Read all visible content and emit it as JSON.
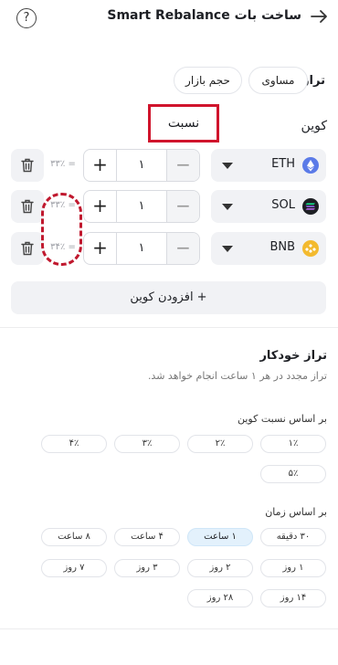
{
  "header": {
    "title": "ساخت بات Smart Rebalance",
    "help_symbol": "?"
  },
  "balance": {
    "label": "تراز",
    "options": [
      "مساوی",
      "حجم بازار"
    ]
  },
  "columns": {
    "coin": "کوین",
    "ratio": "نسبت"
  },
  "coins": [
    {
      "name": "ETH",
      "amount": "۱",
      "percent": "= ۳۳٪",
      "logo_color": "#5b7be8"
    },
    {
      "name": "SOL",
      "amount": "۱",
      "percent": "= ۳۳٪",
      "logo_color": "#7b4fe0"
    },
    {
      "name": "BNB",
      "amount": "۱",
      "percent": "= ۳۴٪",
      "logo_color": "#f3ba2f"
    }
  ],
  "stepper": {
    "plus": "+",
    "minus": "−"
  },
  "add_coin": {
    "label": "+  افزودن کوین"
  },
  "auto": {
    "title": "تراز خودکار",
    "description": "تراز مجدد در هر ۱ ساعت انجام خواهد شد."
  },
  "by_ratio": {
    "title": "بر اساس نسبت کوین",
    "options": [
      "۱٪",
      "۲٪",
      "۳٪",
      "۴٪",
      "۵٪"
    ]
  },
  "by_time": {
    "title": "بر اساس زمان",
    "options": [
      "۳۰ دقیقه",
      "۱ ساعت",
      "۴ ساعت",
      "۸ ساعت",
      "۱ روز",
      "۲ روز",
      "۳ روز",
      "۷ روز",
      "۱۴ روز",
      "۲۸ روز"
    ],
    "selected": "۱ ساعت"
  },
  "colors": {
    "accent_selected": "#e3f1fc",
    "annotation_red": "#d0142c"
  }
}
